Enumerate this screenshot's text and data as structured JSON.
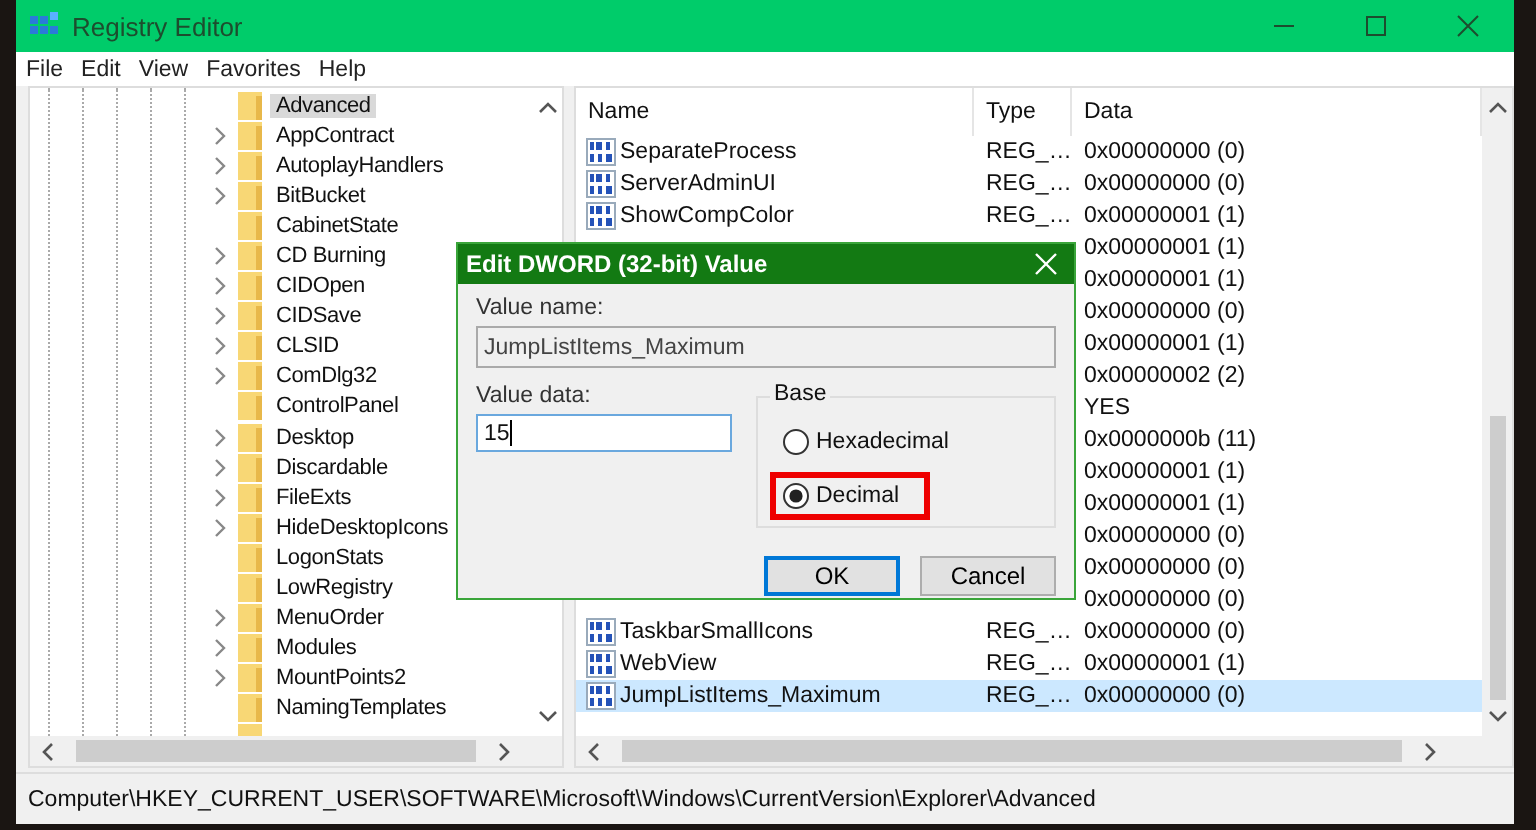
{
  "window": {
    "title": "Registry Editor"
  },
  "menu": [
    "File",
    "Edit",
    "View",
    "Favorites",
    "Help"
  ],
  "tree": {
    "items": [
      {
        "label": "Advanced",
        "expandable": false,
        "selected": true
      },
      {
        "label": "AppContract",
        "expandable": true,
        "selected": false
      },
      {
        "label": "AutoplayHandlers",
        "expandable": true,
        "selected": false
      },
      {
        "label": "BitBucket",
        "expandable": true,
        "selected": false
      },
      {
        "label": "CabinetState",
        "expandable": false,
        "selected": false
      },
      {
        "label": "CD Burning",
        "expandable": true,
        "selected": false
      },
      {
        "label": "CIDOpen",
        "expandable": true,
        "selected": false
      },
      {
        "label": "CIDSave",
        "expandable": true,
        "selected": false
      },
      {
        "label": "CLSID",
        "expandable": true,
        "selected": false
      },
      {
        "label": "ComDlg32",
        "expandable": true,
        "selected": false
      },
      {
        "label": "ControlPanel",
        "expandable": false,
        "selected": false
      },
      {
        "label": "Desktop",
        "expandable": true,
        "selected": false
      },
      {
        "label": "Discardable",
        "expandable": true,
        "selected": false
      },
      {
        "label": "FileExts",
        "expandable": true,
        "selected": false
      },
      {
        "label": "HideDesktopIcons",
        "expandable": true,
        "selected": false
      },
      {
        "label": "LogonStats",
        "expandable": false,
        "selected": false
      },
      {
        "label": "LowRegistry",
        "expandable": false,
        "selected": false
      },
      {
        "label": "MenuOrder",
        "expandable": true,
        "selected": false
      },
      {
        "label": "Modules",
        "expandable": true,
        "selected": false
      },
      {
        "label": "MountPoints2",
        "expandable": true,
        "selected": false
      },
      {
        "label": "NamingTemplates",
        "expandable": false,
        "selected": false
      }
    ]
  },
  "table": {
    "columns": [
      "Name",
      "Type",
      "Data"
    ],
    "rows": [
      {
        "name": "SeparateProcess",
        "type": "REG_…",
        "data": "0x00000000 (0)",
        "selected": false
      },
      {
        "name": "ServerAdminUI",
        "type": "REG_…",
        "data": "0x00000000 (0)",
        "selected": false
      },
      {
        "name": "ShowCompColor",
        "type": "REG_…",
        "data": "0x00000001 (1)",
        "selected": false
      },
      {
        "data": "0x00000001 (1)",
        "selected": false
      },
      {
        "data": "0x00000001 (1)",
        "selected": false
      },
      {
        "data": "0x00000000 (0)",
        "selected": false
      },
      {
        "data": "0x00000001 (1)",
        "selected": false
      },
      {
        "data": "0x00000002 (2)",
        "selected": false
      },
      {
        "data": "YES",
        "selected": false
      },
      {
        "data": "0x0000000b (11)",
        "selected": false
      },
      {
        "data": "0x00000001 (1)",
        "selected": false
      },
      {
        "data": "0x00000001 (1)",
        "selected": false
      },
      {
        "data": "0x00000000 (0)",
        "selected": false
      },
      {
        "data": "0x00000000 (0)",
        "selected": false
      },
      {
        "data": "0x00000000 (0)",
        "selected": false
      },
      {
        "name": "TaskbarSmallIcons",
        "type": "REG_…",
        "data": "0x00000000 (0)",
        "selected": false
      },
      {
        "name": "WebView",
        "type": "REG_…",
        "data": "0x00000001 (1)",
        "selected": false
      },
      {
        "name": "JumpListItems_Maximum",
        "type": "REG_…",
        "data": "0x00000000 (0)",
        "selected": true
      }
    ]
  },
  "dialog": {
    "title": "Edit DWORD (32-bit) Value",
    "value_name_label": "Value name:",
    "value_name": "JumpListItems_Maximum",
    "value_data_label": "Value data:",
    "value_data": "15",
    "base_label": "Base",
    "bases": [
      {
        "label": "Hexadecimal",
        "selected": false,
        "highlighted": false
      },
      {
        "label": "Decimal",
        "selected": true,
        "highlighted": true
      }
    ],
    "buttons": [
      {
        "label": "OK",
        "default": true
      },
      {
        "label": "Cancel",
        "default": false
      }
    ]
  },
  "status_bar": "Computer\\HKEY_CURRENT_USER\\SOFTWARE\\Microsoft\\Windows\\CurrentVersion\\Explorer\\Advanced"
}
